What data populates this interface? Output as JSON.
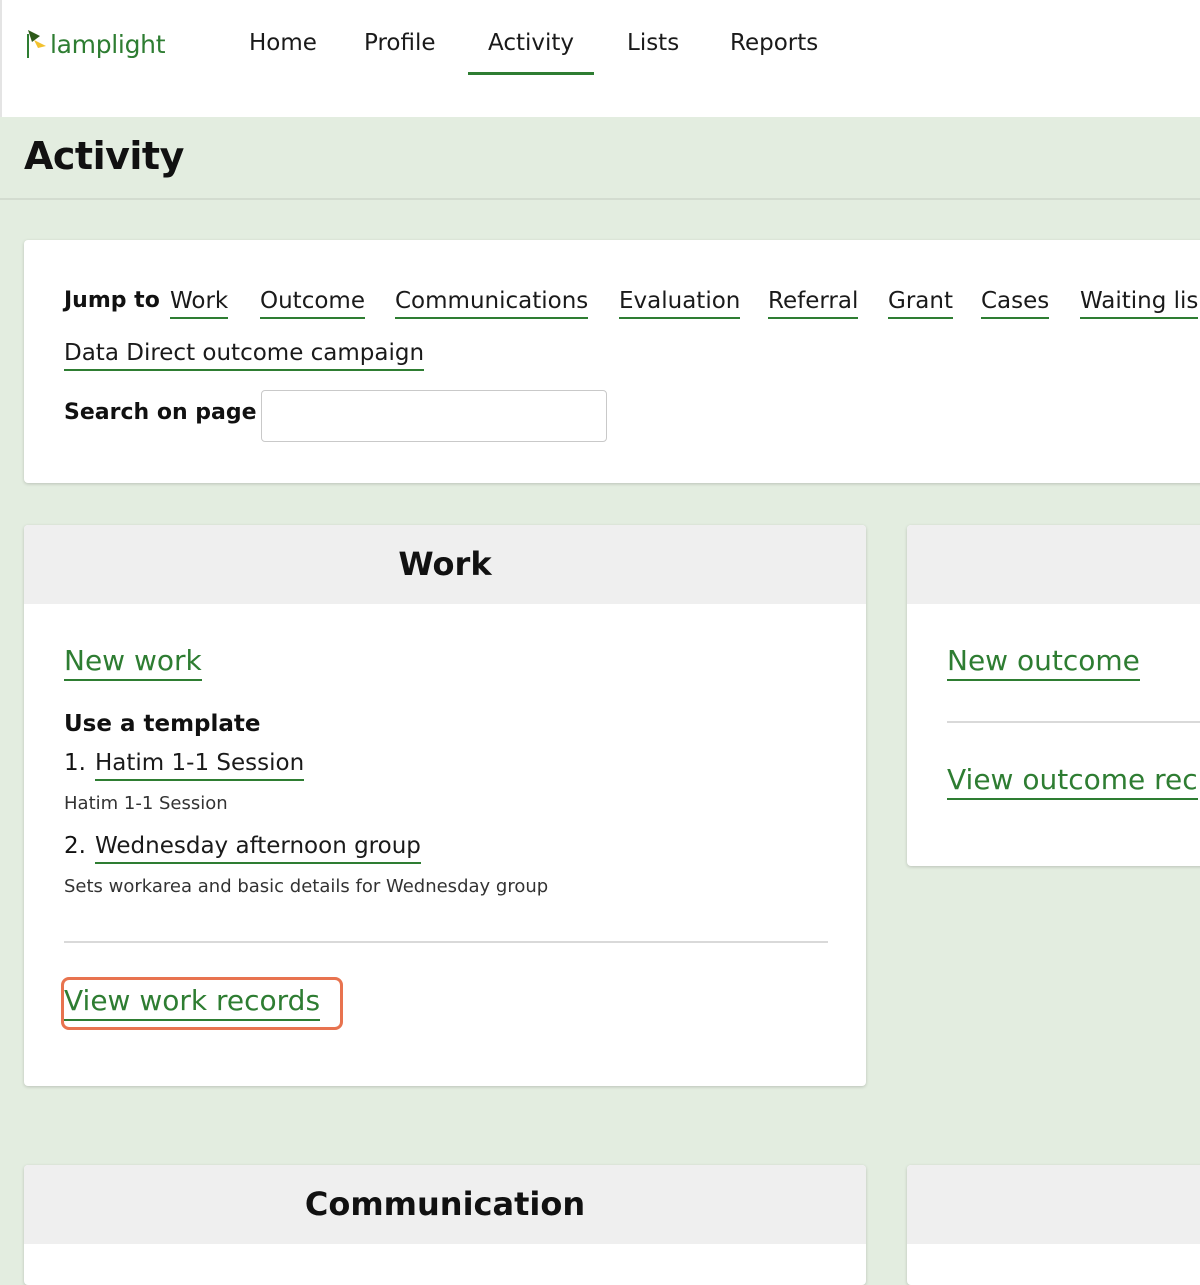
{
  "app": {
    "logo_text": "lamplight"
  },
  "nav": {
    "items": [
      {
        "label": "Home"
      },
      {
        "label": "Profile"
      },
      {
        "label": "Activity",
        "active": true
      },
      {
        "label": "Lists"
      },
      {
        "label": "Reports"
      }
    ]
  },
  "page": {
    "title": "Activity"
  },
  "jump": {
    "label": "Jump to",
    "links": [
      "Work",
      "Outcome",
      "Communications",
      "Evaluation",
      "Referral",
      "Grant",
      "Cases",
      "Waiting lis",
      "Data Direct outcome campaign"
    ],
    "search_label": "Search on page",
    "search_value": ""
  },
  "work": {
    "title": "Work",
    "new_link": "New work",
    "template_heading": "Use a template",
    "templates": [
      {
        "num": "1.",
        "name": "Hatim 1-1 Session",
        "desc": "Hatim 1-1 Session"
      },
      {
        "num": "2.",
        "name": "Wednesday afternoon group",
        "desc": "Sets workarea and basic details for Wednesday group"
      }
    ],
    "view_link": "View work records"
  },
  "outcome": {
    "new_link": "New outcome",
    "view_link": "View outcome rec"
  },
  "communication": {
    "title": "Communication"
  },
  "colors": {
    "accent": "#2e7d32",
    "highlight": "#e8734f",
    "background": "#e3ede0"
  }
}
